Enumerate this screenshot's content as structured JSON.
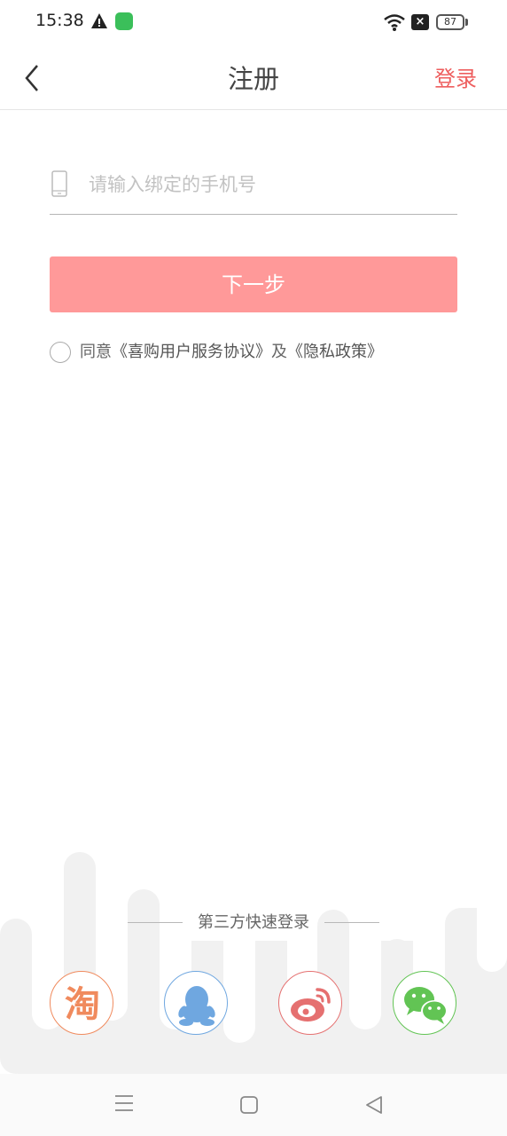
{
  "status_bar": {
    "time": "15:38",
    "battery": "87",
    "icons": [
      "warning-icon",
      "app-notification-icon",
      "wifi-icon",
      "sim-off-icon",
      "battery-icon"
    ]
  },
  "header": {
    "title": "注册",
    "login_label": "登录",
    "back_icon": "chevron-left-icon"
  },
  "form": {
    "phone_placeholder": "请输入绑定的手机号",
    "phone_value": "",
    "phone_icon": "phone-icon",
    "next_label": "下一步",
    "next_color": "#ff9999"
  },
  "agreement": {
    "prefix": "同意",
    "service_link": "《喜购用户服务协议》",
    "conjunction": "及",
    "privacy_link": "《隐私政策》",
    "checked": false
  },
  "third_party": {
    "label": "第三方快速登录",
    "providers": [
      {
        "name": "taobao",
        "icon": "taobao-icon",
        "color": "#f08a5d",
        "glyph": "淘"
      },
      {
        "name": "qq",
        "icon": "qq-icon",
        "color": "#6fa7e0"
      },
      {
        "name": "weibo",
        "icon": "weibo-icon",
        "color": "#e57070"
      },
      {
        "name": "wechat",
        "icon": "wechat-icon",
        "color": "#62c454"
      }
    ]
  },
  "colors": {
    "accent": "#ee5e5e",
    "button": "#ff9999"
  }
}
